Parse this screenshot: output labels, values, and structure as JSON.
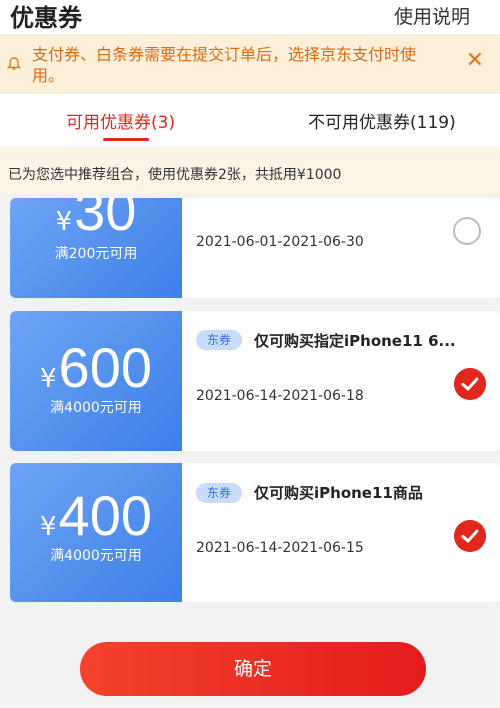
{
  "header": {
    "title": "优惠券",
    "help_label": "使用说明"
  },
  "notice": {
    "text": "支付券、白条券需要在提交订单后，选择京东支付时使用。"
  },
  "tabs": [
    {
      "label": "可用优惠券(3)",
      "active": true
    },
    {
      "label": "不可用优惠券(119)",
      "active": false
    }
  ],
  "tip": {
    "text": "已为您选中推荐组合，使用优惠券2张，共抵用¥1000"
  },
  "coupons": [
    {
      "currency": "¥",
      "amount": "30",
      "condition": "满200元可用",
      "badge": "",
      "name": "",
      "date": "2021-06-01-2021-06-30",
      "selected": false
    },
    {
      "currency": "¥",
      "amount": "600",
      "condition": "满4000元可用",
      "badge": "东券",
      "name": "仅可购买指定iPhone11 6...",
      "date": "2021-06-14-2021-06-18",
      "selected": true
    },
    {
      "currency": "¥",
      "amount": "400",
      "condition": "满4000元可用",
      "badge": "东券",
      "name": "仅可购买iPhone11商品",
      "date": "2021-06-14-2021-06-15",
      "selected": true
    }
  ],
  "confirm_label": "确定",
  "colors": {
    "accent": "#e2281e",
    "coupon_blue": "#3d7fe8",
    "notice_bg": "#fdf0d9"
  }
}
